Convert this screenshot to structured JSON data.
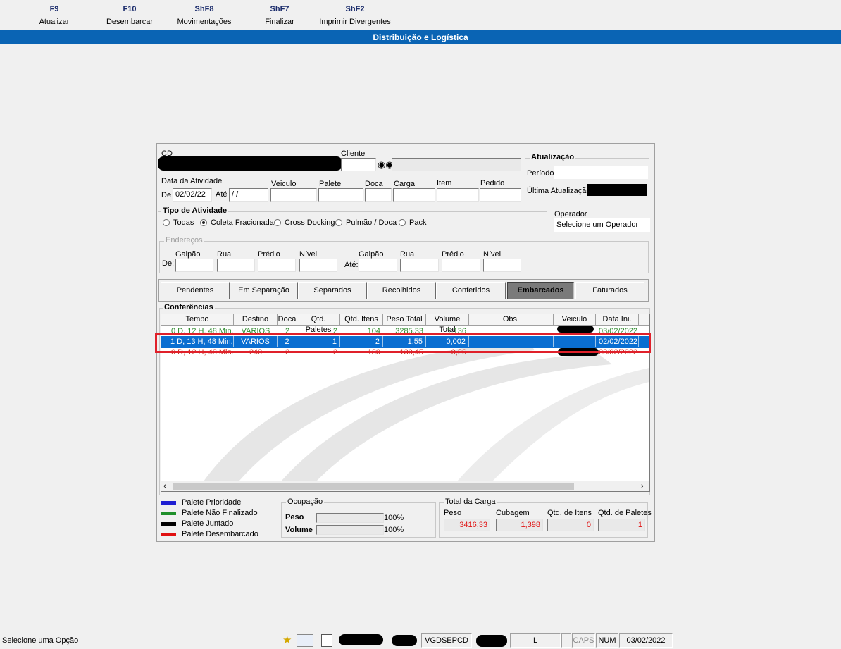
{
  "toolbar": {
    "keys": [
      {
        "key": "F9",
        "label": "Atualizar"
      },
      {
        "key": "F10",
        "label": "Desembarcar"
      },
      {
        "key": "ShF8",
        "label": "Movimentações"
      },
      {
        "key": "ShF7",
        "label": "Finalizar"
      },
      {
        "key": "ShF2",
        "label": "Imprimir Divergentes"
      }
    ]
  },
  "title": "Distribuição e Logística",
  "filters": {
    "cd_label": "CD",
    "cliente_label": "Cliente",
    "data_atividade_label": "Data da Atividade",
    "de_label": "De",
    "de_value": "02/02/22",
    "ate_label": "Até",
    "ate_value": " / /",
    "veiculo_label": "Veiculo",
    "palete_label": "Palete",
    "doca_label": "Doca",
    "carga_label": "Carga",
    "item_label": "Item",
    "pedido_label": "Pedido"
  },
  "atualizacao": {
    "title": "Atualização",
    "periodo_label": "Período",
    "ultima_label": "Última Atualização"
  },
  "tipo_atividade": {
    "title": "Tipo de Atividade",
    "options": [
      "Todas",
      "Coleta Fracionada",
      "Cross Docking",
      "Pulmão / Doca",
      "Pack"
    ],
    "selected": "Coleta Fracionada"
  },
  "operador": {
    "label": "Operador",
    "value": "Selecione um Operador"
  },
  "enderecos": {
    "title": "Endereços",
    "de_label": "De:",
    "ate_label": "Até:",
    "galpao": "Galpão",
    "rua": "Rua",
    "predio": "Prédio",
    "nivel": "Nível"
  },
  "tabs": [
    "Pendentes",
    "Em Separação",
    "Separados",
    "Recolhidos",
    "Conferidos",
    "Embarcados",
    "Faturados"
  ],
  "active_tab": "Embarcados",
  "conferencias": {
    "title": "Conferências",
    "columns": [
      "Tempo",
      "Destino",
      "Doca",
      "Qtd. Paletes",
      "Qtd. Itens",
      "Peso Total",
      "Volume Total",
      "Obs.",
      "Veiculo",
      "Data Ini."
    ],
    "rows": [
      {
        "tempo": "0 D, 12 H, 48 Min.",
        "destino": "VARIOS",
        "doca": "2",
        "paletes": "2",
        "itens": "104",
        "peso": "3285,33",
        "volume": "1,136",
        "obs": "",
        "data": "03/02/2022",
        "color": "#2e8b2e"
      },
      {
        "tempo": "1 D, 13 H, 48 Min.",
        "destino": "VARIOS",
        "doca": "2",
        "paletes": "1",
        "itens": "2",
        "peso": "1,55",
        "volume": "0,002",
        "obs": "",
        "data": "02/02/2022",
        "color": "#ffffff"
      },
      {
        "tempo": "0 D, 12 H, 48 Min.",
        "destino": "240",
        "doca": "2",
        "paletes": "2",
        "itens": "130",
        "peso": "130,45",
        "volume": "0,26",
        "obs": "",
        "data": "03/02/2022",
        "color": "#c8281e"
      }
    ]
  },
  "legend": [
    {
      "label": "Palete Prioridade",
      "color": "#1f1fd2"
    },
    {
      "label": "Palete Não Finalizado",
      "color": "#1f8f2a"
    },
    {
      "label": "Palete Juntado",
      "color": "#000000"
    },
    {
      "label": "Palete Desembarcado",
      "color": "#e01010"
    }
  ],
  "ocupacao": {
    "title": "Ocupação",
    "peso_label": "Peso",
    "peso_pct": "100%",
    "volume_label": "Volume",
    "volume_pct": "100%"
  },
  "total_carga": {
    "title": "Total da Carga",
    "peso_label": "Peso",
    "peso_value": "3416,33",
    "cubagem_label": "Cubagem",
    "cubagem_value": "1,398",
    "itens_label": "Qtd. de Itens",
    "itens_value": "0",
    "paletes_label": "Qtd. de Paletes",
    "paletes_value": "1"
  },
  "statusbar": {
    "message": "Selecione uma Opção",
    "station": "VGDSEPCD",
    "mode": "L",
    "caps": "CAPS",
    "num": "NUM",
    "date": "03/02/2022"
  }
}
